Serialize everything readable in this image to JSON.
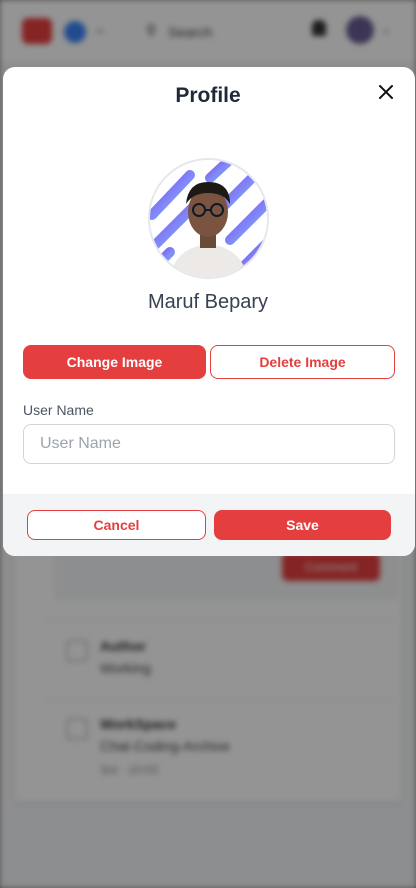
{
  "background": {
    "search_label": "Search",
    "action_button_label": "Comment",
    "items": [
      {
        "title": "Author",
        "subtitle": "Working"
      },
      {
        "title": "WorkSpace",
        "subtitle": "Chat-Coding-Archive",
        "meta": "3rd · 10:03"
      }
    ]
  },
  "modal": {
    "title": "Profile",
    "user_display_name": "Maruf Bepary",
    "change_image_label": "Change Image",
    "delete_image_label": "Delete Image",
    "username_field": {
      "label": "User Name",
      "placeholder": "User Name",
      "value": ""
    },
    "cancel_label": "Cancel",
    "save_label": "Save"
  },
  "colors": {
    "accent": "#e53e3e",
    "overlay": "rgba(0,0,0,0.42)",
    "footer_bg": "#f3f4f6"
  },
  "icons": {
    "close": "close-icon"
  }
}
